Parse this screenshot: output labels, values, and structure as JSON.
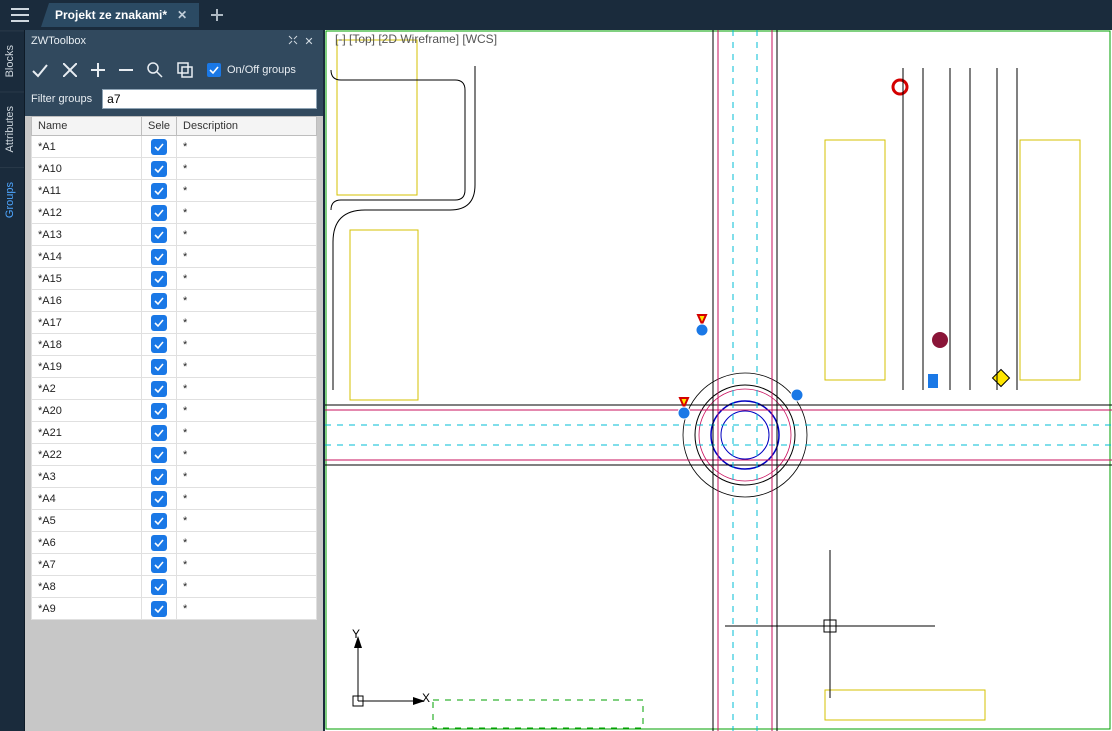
{
  "header": {
    "tab_title": "Projekt ze znakami*"
  },
  "side_tabs": [
    {
      "label": "Blocks",
      "active": false
    },
    {
      "label": "Attributes",
      "active": false
    },
    {
      "label": "Groups",
      "active": true
    }
  ],
  "panel": {
    "title": "ZWToolbox",
    "onoff_label": "On/Off groups",
    "filter_label": "Filter groups",
    "filter_value": "a7"
  },
  "table": {
    "headers": [
      "Name",
      "Sele",
      "Description"
    ],
    "rows": [
      {
        "name": "*A1",
        "selected": true,
        "desc": "*"
      },
      {
        "name": "*A10",
        "selected": true,
        "desc": "*"
      },
      {
        "name": "*A11",
        "selected": true,
        "desc": "*"
      },
      {
        "name": "*A12",
        "selected": true,
        "desc": "*"
      },
      {
        "name": "*A13",
        "selected": true,
        "desc": "*"
      },
      {
        "name": "*A14",
        "selected": true,
        "desc": "*"
      },
      {
        "name": "*A15",
        "selected": true,
        "desc": "*"
      },
      {
        "name": "*A16",
        "selected": true,
        "desc": "*"
      },
      {
        "name": "*A17",
        "selected": true,
        "desc": "*"
      },
      {
        "name": "*A18",
        "selected": true,
        "desc": "*"
      },
      {
        "name": "*A19",
        "selected": true,
        "desc": "*"
      },
      {
        "name": "*A2",
        "selected": true,
        "desc": "*"
      },
      {
        "name": "*A20",
        "selected": true,
        "desc": "*"
      },
      {
        "name": "*A21",
        "selected": true,
        "desc": "*"
      },
      {
        "name": "*A22",
        "selected": true,
        "desc": "*"
      },
      {
        "name": "*A3",
        "selected": true,
        "desc": "*"
      },
      {
        "name": "*A4",
        "selected": true,
        "desc": "*"
      },
      {
        "name": "*A5",
        "selected": true,
        "desc": "*"
      },
      {
        "name": "*A6",
        "selected": true,
        "desc": "*"
      },
      {
        "name": "*A7",
        "selected": true,
        "desc": "*"
      },
      {
        "name": "*A8",
        "selected": true,
        "desc": "*"
      },
      {
        "name": "*A9",
        "selected": true,
        "desc": "*"
      }
    ]
  },
  "viewport": {
    "label": "[-] [Top] [2D Wireframe] [WCS]",
    "axis_y": "Y",
    "axis_x": "X"
  },
  "colors": {
    "accent": "#1a78e6",
    "header_bg": "#1a2b3c",
    "panel_bg": "#31495e"
  }
}
